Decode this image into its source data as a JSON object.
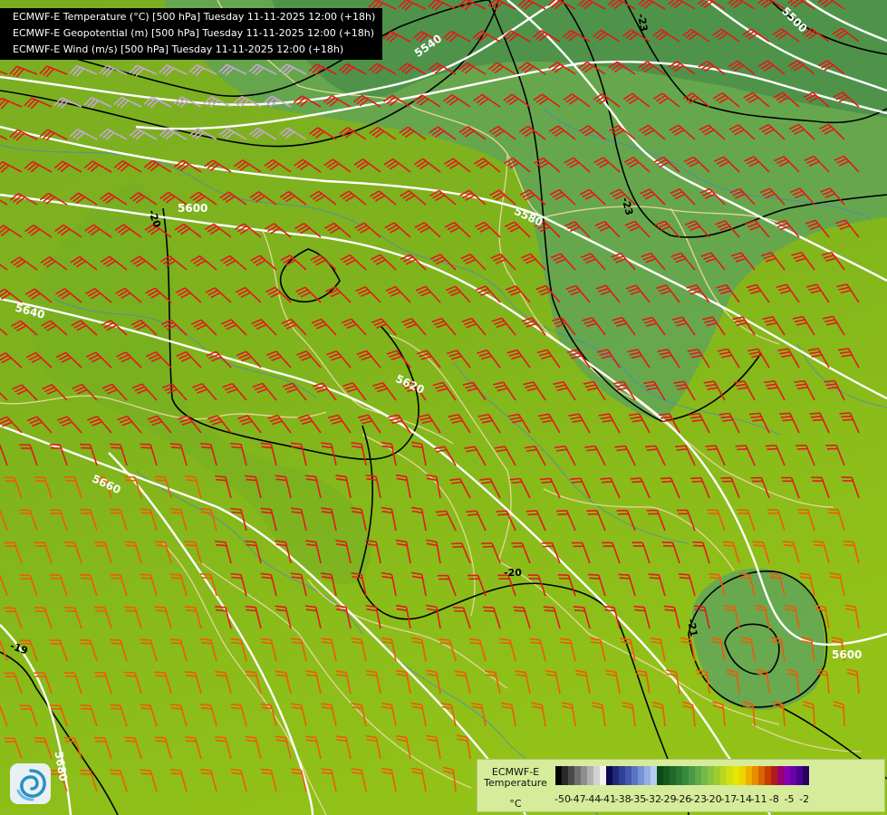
{
  "header": {
    "lines": [
      "ECMWF-E Temperature (°C) [500 hPa] Tuesday 11-11-2025 12:00 (+18h)",
      "ECMWF-E Geopotential (m) [500 hPa] Tuesday 11-11-2025 12:00 (+18h)",
      "ECMWF-E Wind (m/s) [500 hPa] Tuesday 11-11-2025 12:00 (+18h)"
    ]
  },
  "legend": {
    "title_line1": "ECMWF-E",
    "title_line2": "Temperature",
    "unit": "°C",
    "tick_labels": [
      "-50",
      "-47",
      "-44",
      "-41",
      "-38",
      "-35",
      "-32",
      "-29",
      "-26",
      "-23",
      "-20",
      "-17",
      "-14",
      "-11",
      "-8",
      "-5",
      "-2"
    ],
    "colors": [
      "#050505",
      "#2a2a2a",
      "#4a4a4a",
      "#6e6e6e",
      "#8e8e8e",
      "#b0b0b0",
      "#d2d2d2",
      "#f2f2f2",
      "#0a0a50",
      "#1e2a78",
      "#2f3f96",
      "#4358ae",
      "#5a74c4",
      "#7592d6",
      "#94b0e4",
      "#b4cdef",
      "#0a4a14",
      "#155a1e",
      "#1f6a28",
      "#2a7a32",
      "#388a3c",
      "#4a9a46",
      "#5eaa48",
      "#74b84a",
      "#8ac33c",
      "#a0cd2e",
      "#b8d81e",
      "#d0e010",
      "#e6e600",
      "#f0d400",
      "#f0b000",
      "#e88c00",
      "#d86400",
      "#c83c00",
      "#b01c1c",
      "#9a0070",
      "#8a00b0",
      "#6a00a8",
      "#4a0090",
      "#2a0060"
    ]
  },
  "map": {
    "geopotential_labels": [
      {
        "text": "5540"
      },
      {
        "text": "5500"
      },
      {
        "text": "5580"
      },
      {
        "text": "5600"
      },
      {
        "text": "5640"
      },
      {
        "text": "5620"
      },
      {
        "text": "5660"
      },
      {
        "text": "5600"
      },
      {
        "text": "5680"
      }
    ],
    "temperature_labels": [
      {
        "text": "-23"
      },
      {
        "text": "-23"
      },
      {
        "text": "-20"
      },
      {
        "text": "-20"
      },
      {
        "text": "-21"
      },
      {
        "text": "-19"
      }
    ]
  },
  "colors": {
    "field_warm": "#8dbe1e",
    "field_mid": "#6aa42a",
    "field_cold": "#58a05a",
    "isohypse": "#ffffff",
    "isotherm": "#000000",
    "border": "#e6d49a",
    "river": "#4a84c8",
    "barb_red": "#e21a1a",
    "barb_orange": "#f05a0a",
    "barb_lilac": "#c8a6d6"
  }
}
